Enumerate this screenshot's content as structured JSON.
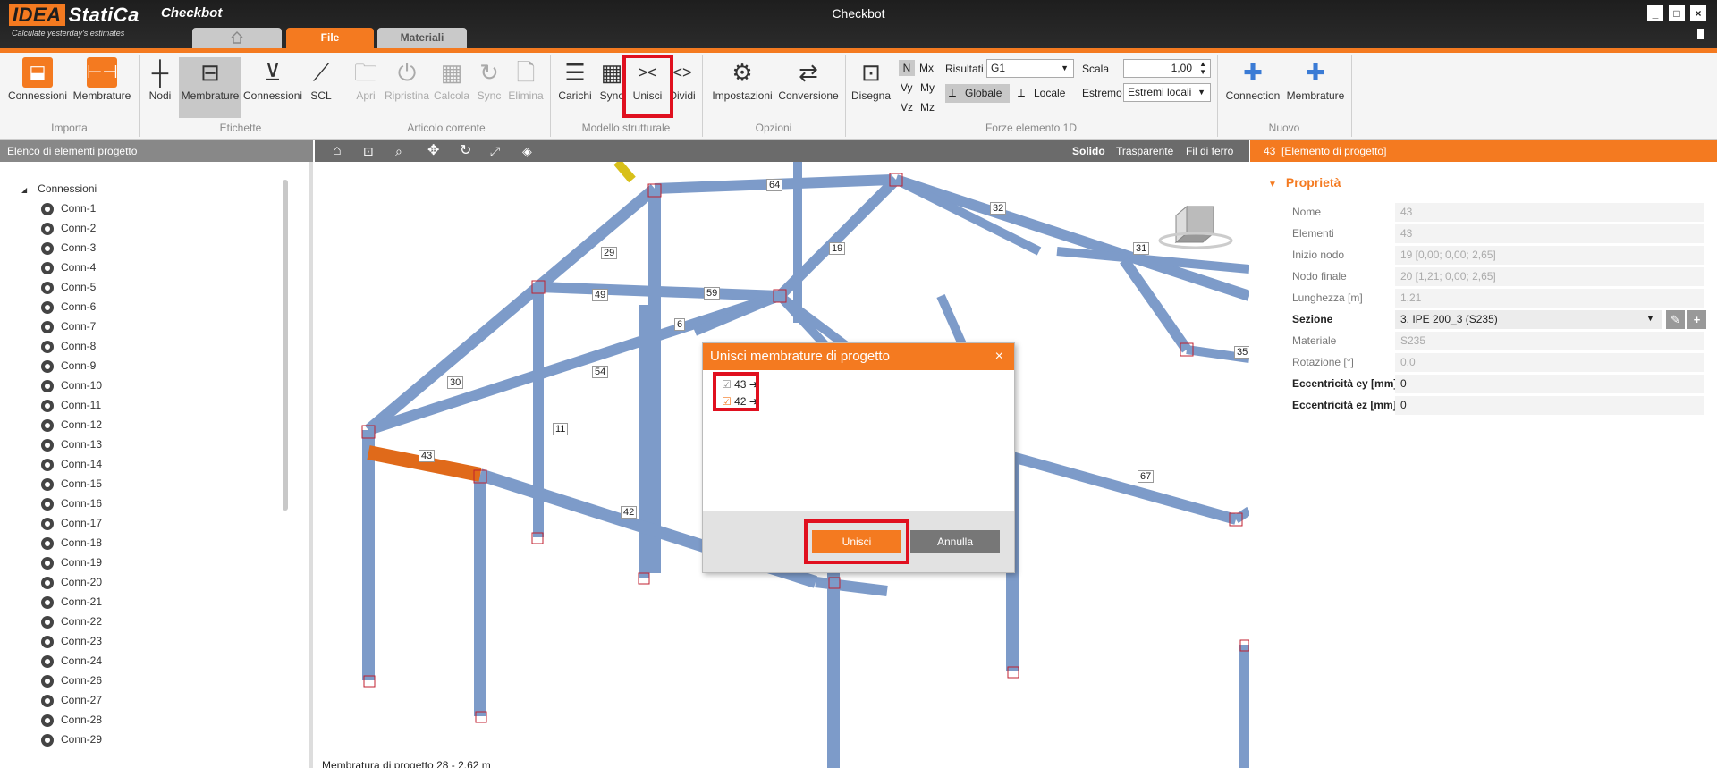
{
  "app": {
    "logo_brand": "IDEA",
    "logo_product": "StatiCa",
    "tagline": "Calculate yesterday's estimates",
    "app_name": "Checkbot",
    "window_title": "Checkbot"
  },
  "tabs": [
    {
      "label": ""
    },
    {
      "label": "File"
    },
    {
      "label": "Materiali"
    }
  ],
  "ribbon": {
    "importa": {
      "label": "Importa",
      "items": [
        "Connessioni",
        "Membrature"
      ]
    },
    "etichette": {
      "label": "Etichette",
      "items": [
        "Nodi",
        "Membrature",
        "Connessioni",
        "SCL"
      ]
    },
    "articolo": {
      "label": "Articolo corrente",
      "items": [
        "Apri",
        "Ripristina",
        "Calcola",
        "Sync",
        "Elimina"
      ]
    },
    "modello": {
      "label": "Modello strutturale",
      "items": [
        "Carichi",
        "Sync",
        "Unisci",
        "Dividi"
      ]
    },
    "opzioni": {
      "label": "Opzioni",
      "items": [
        "Impostazioni",
        "Conversione"
      ]
    },
    "forze": {
      "label": "Forze elemento 1D",
      "disegna": "Disegna",
      "components": [
        "N",
        "Mx",
        "Vy",
        "My",
        "Vz",
        "Mz"
      ],
      "risultati_label": "Risultati",
      "risultati_value": "G1",
      "scala_label": "Scala",
      "scala_value": "1,00",
      "estremo_label": "Estremo",
      "estremo_value": "Estremi locali",
      "globale": "Globale",
      "locale": "Locale"
    },
    "nuovo": {
      "label": "Nuovo",
      "items": [
        "Connection",
        "Membrature"
      ]
    }
  },
  "left_panel": {
    "title": "Elenco di elementi progetto",
    "root": "Connessioni",
    "items": [
      "Conn-1",
      "Conn-2",
      "Conn-3",
      "Conn-4",
      "Conn-5",
      "Conn-6",
      "Conn-7",
      "Conn-8",
      "Conn-9",
      "Conn-10",
      "Conn-11",
      "Conn-12",
      "Conn-13",
      "Conn-14",
      "Conn-15",
      "Conn-16",
      "Conn-17",
      "Conn-18",
      "Conn-19",
      "Conn-20",
      "Conn-21",
      "Conn-22",
      "Conn-23",
      "Conn-24",
      "Conn-26",
      "Conn-27",
      "Conn-28",
      "Conn-29"
    ]
  },
  "viewport": {
    "view_modes": [
      "Solido",
      "Trasparente",
      "Fil di ferro"
    ],
    "status": "Membratura di progetto 28 - 2.62 m",
    "member_labels": [
      "64",
      "32",
      "29",
      "19",
      "31",
      "49",
      "59",
      "6",
      "54",
      "30",
      "11",
      "43",
      "42",
      "67",
      "35"
    ]
  },
  "dialog": {
    "title": "Unisci membrature di progetto",
    "items": [
      "43",
      "42"
    ],
    "ok": "Unisci",
    "cancel": "Annulla"
  },
  "right_panel": {
    "header_id": "43",
    "header_title": "[Elemento di progetto]",
    "section_title": "Proprietà",
    "props": [
      {
        "label": "Nome",
        "value": "43"
      },
      {
        "label": "Elementi",
        "value": "43"
      },
      {
        "label": "Inizio nodo",
        "value": "19 [0,00; 0,00; 2,65]"
      },
      {
        "label": "Nodo finale",
        "value": "20 [1,21; 0,00; 2,65]"
      },
      {
        "label": "Lunghezza [m]",
        "value": "1,21"
      },
      {
        "label": "Sezione",
        "value": "3. IPE 200_3 (S235)"
      },
      {
        "label": "Materiale",
        "value": "S235"
      },
      {
        "label": "Rotazione [°]",
        "value": "0,0"
      },
      {
        "label": "Eccentricità ey [mm]",
        "value": "0"
      },
      {
        "label": "Eccentricità ez [mm]",
        "value": "0"
      }
    ]
  },
  "colors": {
    "accent": "#f47a20",
    "beam": "#7d9bc9",
    "highlight": "#e0101f",
    "dark_bar": "#2a2a2a"
  }
}
